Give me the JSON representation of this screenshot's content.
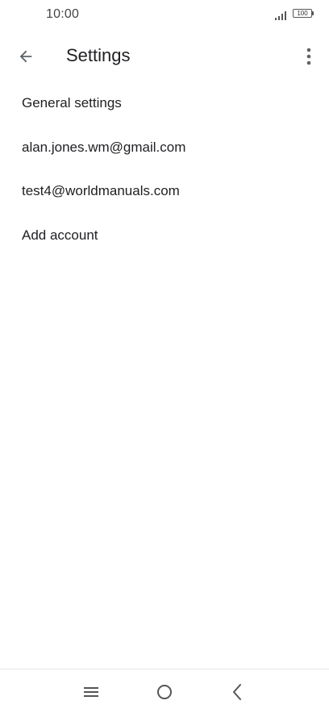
{
  "status_bar": {
    "time": "10:00",
    "battery": "100",
    "icons": [
      "signal-icon",
      "battery-icon"
    ]
  },
  "app_bar": {
    "title": "Settings",
    "icons": [
      "back-arrow-icon",
      "more-vert-icon"
    ]
  },
  "settings": {
    "items": [
      {
        "label": "General settings"
      },
      {
        "label": "alan.jones.wm@gmail.com"
      },
      {
        "label": "test4@worldmanuals.com"
      },
      {
        "label": "Add account"
      }
    ]
  },
  "nav_bar": {
    "icons": [
      "menu-icon",
      "home-icon",
      "back-icon"
    ]
  },
  "colors": {
    "text": "#202124",
    "icon": "#5f6368",
    "background": "#ffffff"
  }
}
